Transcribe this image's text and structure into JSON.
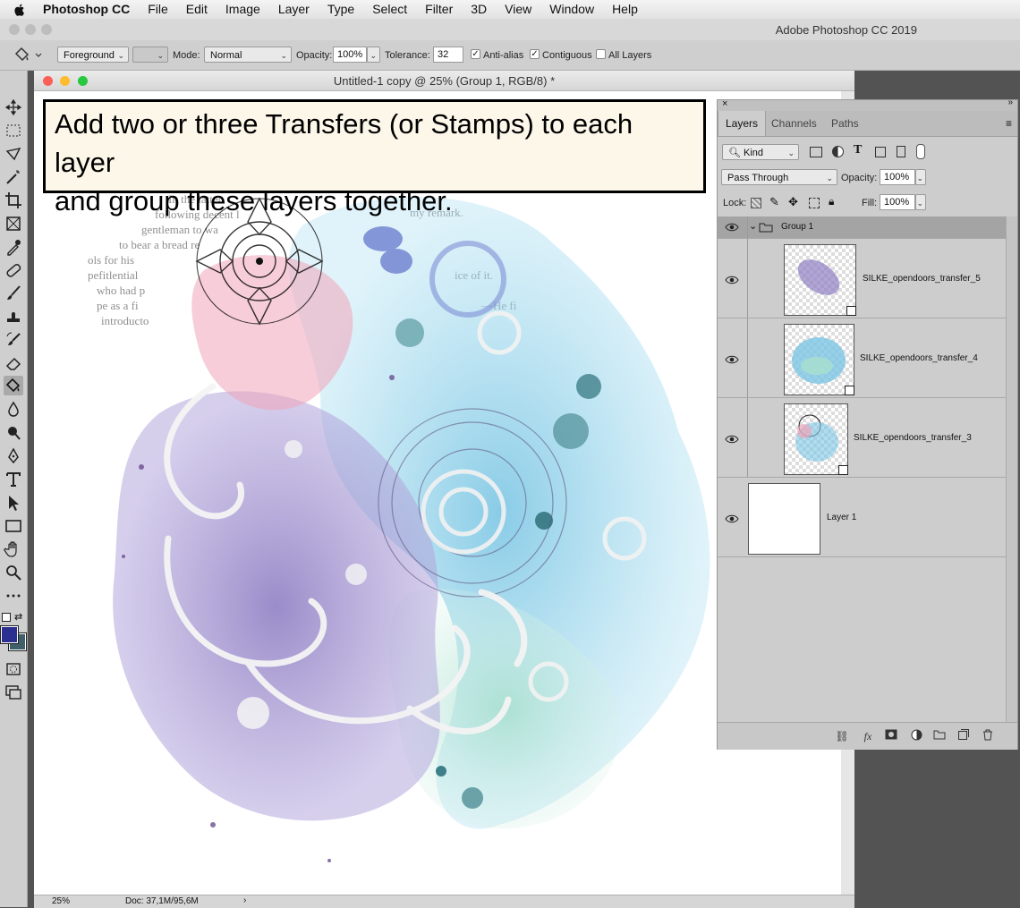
{
  "menubar": {
    "app": "Photoshop CC",
    "items": [
      "File",
      "Edit",
      "Image",
      "Layer",
      "Type",
      "Select",
      "Filter",
      "3D",
      "View",
      "Window",
      "Help"
    ]
  },
  "app_title": "Adobe Photoshop CC 2019",
  "options": {
    "fill_source": "Foreground",
    "mode_label": "Mode:",
    "mode_value": "Normal",
    "opacity_label": "Opacity:",
    "opacity_value": "100%",
    "tolerance_label": "Tolerance:",
    "tolerance_value": "32",
    "antialias_label": "Anti-alias",
    "antialias_checked": true,
    "contiguous_label": "Contiguous",
    "contiguous_checked": true,
    "all_layers_label": "All Layers",
    "all_layers_checked": false
  },
  "document": {
    "title": "Untitled-1 copy @ 25% (Group 1, RGB/8) *",
    "zoom": "25%",
    "doc_size": "Doc: 37,1M/95,6M",
    "callout_line1": "Add two or three Transfers (or Stamps) to each layer",
    "callout_line2": "and group these layers together."
  },
  "colors": {
    "foreground": "#2b2f8f",
    "background": "#3f5f6a",
    "close": "#fc5f57",
    "minimize": "#fdbc2e",
    "zoom": "#28c840",
    "selected_row": "#a4a4a4"
  },
  "layers_panel": {
    "tabs": [
      "Layers",
      "Channels",
      "Paths"
    ],
    "active_tab": "Layers",
    "filter_kind": "Kind",
    "blend_mode": "Pass Through",
    "opacity_label": "Opacity:",
    "opacity_value": "100%",
    "lock_label": "Lock:",
    "fill_label": "Fill:",
    "fill_value": "100%",
    "group_name": "Group 1",
    "layers": [
      {
        "name": "SILKE_opendoors_transfer_5"
      },
      {
        "name": "SILKE_opendoors_transfer_4"
      },
      {
        "name": "SILKE_opendoors_transfer_3"
      },
      {
        "name": "Layer 1"
      }
    ],
    "footer_icons": [
      "link-icon",
      "fx-icon",
      "mask-icon",
      "adjustment-icon",
      "folder-icon",
      "new-layer-icon",
      "trash-icon"
    ]
  }
}
